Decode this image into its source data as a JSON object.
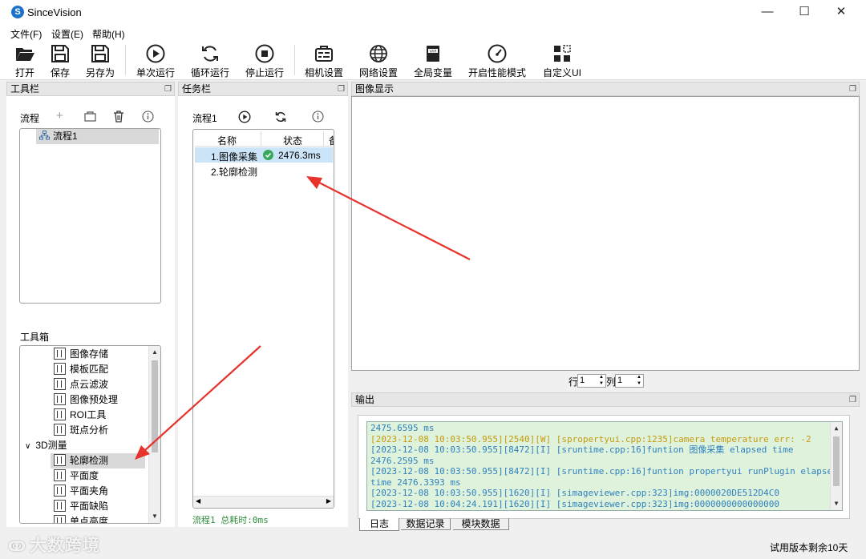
{
  "app": {
    "title": "SinceVision",
    "logo_letter": "S"
  },
  "window_controls": {
    "minimize": "—",
    "maximize": "☐",
    "close": "✕"
  },
  "menu": [
    "文件(F)",
    "设置(E)",
    "帮助(H)"
  ],
  "toolbar": {
    "open": "打开",
    "save": "保存",
    "save_as": "另存为",
    "run_once": "单次运行",
    "run_loop": "循环运行",
    "stop": "停止运行",
    "camera_settings": "相机设置",
    "network_settings": "网络设置",
    "global_vars": "全局变量",
    "perf_mode": "开启性能模式",
    "custom_ui": "自定义UI"
  },
  "toolbar_panel": {
    "title": "工具栏",
    "flow_label": "流程",
    "flows": [
      "流程1"
    ],
    "toolbox_label": "工具箱",
    "tools": [
      "图像存储",
      "模板匹配",
      "点云滤波",
      "图像预处理",
      "ROI工具",
      "斑点分析"
    ],
    "group_3d": "3D测量",
    "tools_3d": [
      "轮廓检测",
      "平面度",
      "平面夹角",
      "平面缺陷",
      "单点高度"
    ],
    "selected_tool": "轮廓检测"
  },
  "task_panel": {
    "title": "任务栏",
    "flow_name": "流程1",
    "columns": [
      "名称",
      "状态",
      "备"
    ],
    "rows": [
      {
        "name": "1.图像采集",
        "status": "2476.3ms",
        "ok": true
      },
      {
        "name": "2.轮廓检测",
        "status": "",
        "ok": false
      }
    ],
    "footer": "流程1 总耗时:0ms"
  },
  "image_panel": {
    "title": "图像显示",
    "row_label": "行",
    "row_value": "1",
    "col_label": "列",
    "col_value": "1"
  },
  "output_panel": {
    "title": "输出",
    "log": [
      {
        "text": "2475.6595 ms",
        "level": "I"
      },
      {
        "text": "[2023-12-08 10:03:50.955][2540][W] [spropertyui.cpp:1235]camera temperature err: -2",
        "level": "W"
      },
      {
        "text": "[2023-12-08 10:03:50.955][8472][I] [sruntime.cpp:16]funtion 图像采集 elapsed time",
        "level": "I"
      },
      {
        "text": "2476.2595 ms",
        "level": "I"
      },
      {
        "text": "[2023-12-08 10:03:50.955][8472][I] [sruntime.cpp:16]funtion propertyui runPlugin elapsed",
        "level": "I"
      },
      {
        "text": "time 2476.3393 ms",
        "level": "I"
      },
      {
        "text": "[2023-12-08 10:03:50.955][1620][I] [simageviewer.cpp:323]img:0000020DE512D4C0",
        "level": "I"
      },
      {
        "text": "[2023-12-08 10:04:24.191][1620][I] [simageviewer.cpp:323]img:0000000000000000",
        "level": "I"
      }
    ],
    "tabs": [
      "日志",
      "数据记录",
      "模块数据"
    ]
  },
  "status_bar": {
    "trial": "试用版本剩余10天"
  },
  "watermark": "大数跨境",
  "colors": {
    "accent_blue": "#1a73c9",
    "log_bg": "#dff3dc",
    "log_info": "#2f7fbf",
    "log_warn": "#c59a0e",
    "ok_green": "#3aa85a",
    "arrow_red": "#e8322c"
  }
}
